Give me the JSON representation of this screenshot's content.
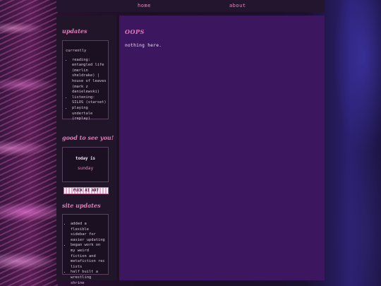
{
  "nav": {
    "items": [
      {
        "label": "home"
      },
      {
        "label": "about"
      }
    ]
  },
  "sidebar": {
    "updates_heading": "updates",
    "currently": {
      "label": "currently",
      "items": [
        "reading: entangled life (merlin sheldrake) | house of leaves (mark z danielewski)",
        "listening: SILOS (starset)",
        "playing undertale (replay)"
      ]
    },
    "greeting_heading": "good to see you!",
    "today": {
      "label": "today is",
      "day": "sunday"
    },
    "badge_text": "FUCK AI ART",
    "site_updates_heading": "site updates",
    "site_updates": [
      "added a flexible sidebar for easier updating",
      "began work on my weird fiction and metafiction rec lists",
      "half built a wrestling shrine"
    ]
  },
  "main": {
    "title": "OOPS",
    "text": "nothing here."
  },
  "colors": {
    "accent": "#e37ab8",
    "main_bg": "#3c1760",
    "sidebar_bg": "#211629"
  }
}
